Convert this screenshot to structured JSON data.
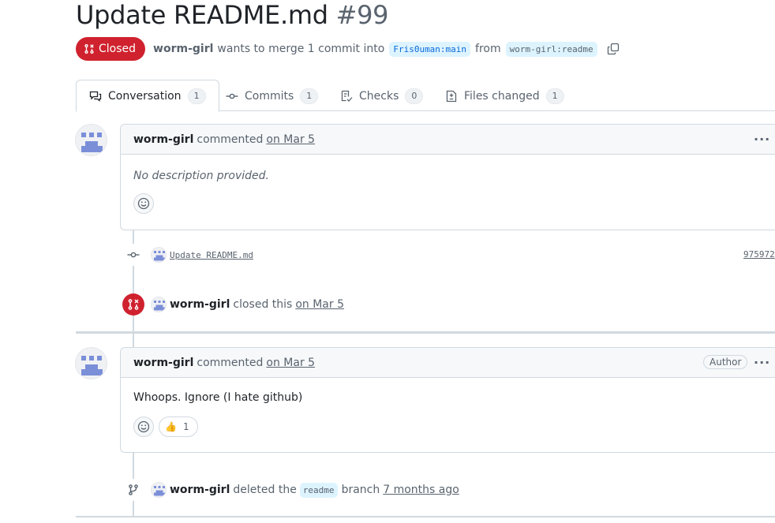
{
  "pr": {
    "title": "Update README.md",
    "number": "#99",
    "state": "Closed",
    "author": "worm-girl",
    "merge_text": "wants to merge 1 commit into",
    "base_branch": "Fris0uman:main",
    "from_text": "from",
    "head_branch": "worm-girl:readme"
  },
  "tabs": [
    {
      "label": "Conversation",
      "count": "1",
      "icon": "comment-discussion-icon"
    },
    {
      "label": "Commits",
      "count": "1",
      "icon": "git-commit-icon"
    },
    {
      "label": "Checks",
      "count": "0",
      "icon": "checklist-icon"
    },
    {
      "label": "Files changed",
      "count": "1",
      "icon": "file-diff-icon"
    }
  ],
  "timeline": {
    "comment1": {
      "author": "worm-girl",
      "action": "commented",
      "date": "on Mar 5",
      "body": "No description provided."
    },
    "commit": {
      "message": "Update README.md",
      "sha": "975972"
    },
    "closed_event": {
      "author": "worm-girl",
      "action": "closed this",
      "date": "on Mar 5"
    },
    "comment2": {
      "author": "worm-girl",
      "action": "commented",
      "date": "on Mar 5",
      "label": "Author",
      "body": "Whoops. Ignore (I hate github)",
      "reaction_emoji": "👍",
      "reaction_count": "1"
    },
    "deleted_event": {
      "author": "worm-girl",
      "action": "deleted the",
      "branch": "readme",
      "suffix": "branch",
      "date": "7 months ago"
    }
  },
  "colors": {
    "closed": "#cf222e",
    "branch_bg": "#ddf4ff",
    "branch_fg": "#0969da",
    "avatar": "#7b8fd8"
  }
}
